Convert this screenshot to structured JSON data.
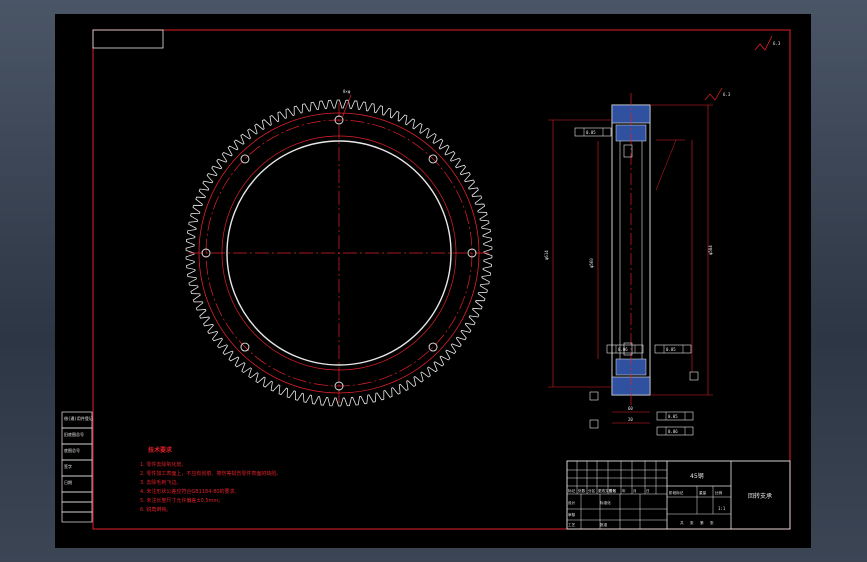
{
  "colors": {
    "frame": "#e0202a",
    "drawing_bg": "#000000",
    "ink_white": "#e8e8e8",
    "hatch_blue": "#3050a0"
  },
  "drawing": {
    "teeth_count": 110,
    "bolt_holes": 8,
    "material": "45钢",
    "part_name": "回转支承",
    "scale": "1:1"
  },
  "left_table": [
    "借(通)用件登记",
    "旧底图总号",
    "底图总号",
    "签字",
    "日期"
  ],
  "notes": {
    "title": "技术要求",
    "items": [
      "1. 零件去除氧化皮。",
      "2. 零件加工表面上，不应有划痕、擦伤等损伤零件表面的缺陷。",
      "3. 去除毛刺飞边。",
      "4. 未注形状公差应符合GB1184-80的要求。",
      "5. 未注长度尺寸允许偏差±0.5mm。",
      "6. 锐角倒钝。"
    ]
  },
  "title_block": {
    "row_header": [
      "标记",
      "处数",
      "分区",
      "更改文件号",
      "签名",
      "年",
      "月",
      "日"
    ],
    "labels": [
      "设计",
      "标准化",
      "审核",
      "工艺",
      "批准",
      "阶段标记",
      "重量",
      "比例",
      "共",
      "张",
      "第",
      "张"
    ]
  },
  "dimensions": {
    "hole_callout": "8×φ",
    "bore": "φ560",
    "outer": "φ614",
    "pcd": "φ584",
    "width": "60",
    "h1": "20",
    "tol1": "0.05",
    "tol2": "0.06",
    "rough": "6.3"
  }
}
